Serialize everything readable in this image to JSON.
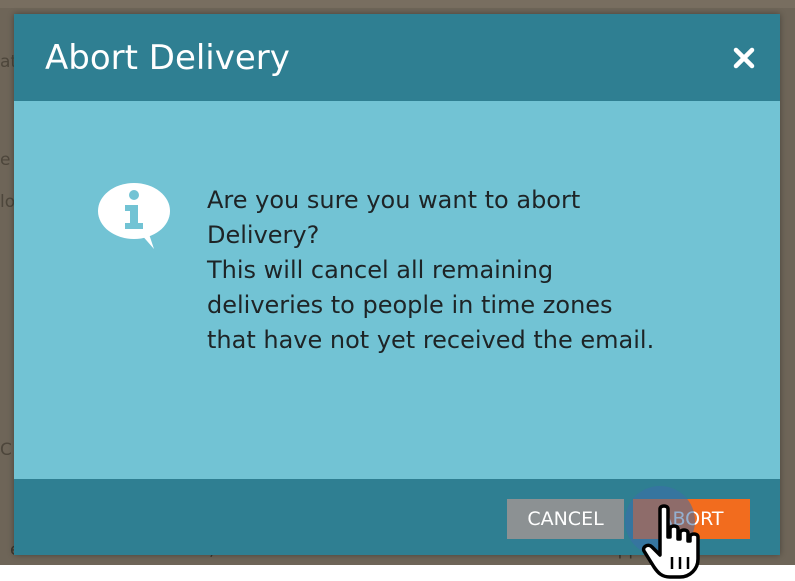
{
  "background": {
    "row_fragments": [
      {
        "text": "at",
        "glyph": true
      },
      {
        "text": "e",
        "glyph": true
      },
      {
        "text": "lo",
        "glyph": true
      },
      {
        "text": "C",
        "glyph": true
      }
    ],
    "bottom_row": {
      "left_text": "end Email",
      "date_text": "Feb 18, 2016 2:56 PM",
      "right_text": "App"
    }
  },
  "dialog": {
    "title": "Abort Delivery",
    "close_icon": "close-icon",
    "info_icon": "info-speech-bubble-icon",
    "message_lines": [
      "Are you sure you want to abort",
      "Delivery?",
      "This will cancel all remaining",
      "deliveries to people in time zones",
      "that have not yet received the email."
    ],
    "buttons": {
      "cancel": "CANCEL",
      "abort": "ABORT"
    }
  },
  "colors": {
    "header": "#2f7f92",
    "body": "#72c3d4",
    "cancel_button": "#8c9193",
    "abort_button": "#f26c1e"
  }
}
